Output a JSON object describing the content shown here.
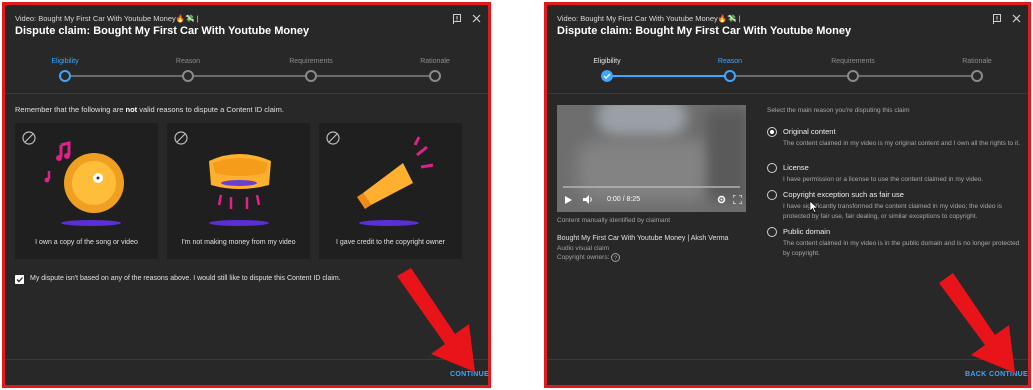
{
  "panel1": {
    "video_title": "Video: Bought My First Car With Youtube Money🔥💸 |",
    "dialog_title": "Dispute claim: Bought My First Car With Youtube Money",
    "steps": [
      "Eligibility",
      "Reason",
      "Requirements",
      "Rationale"
    ],
    "active_step": "Eligibility",
    "note_before": "Remember that the following are ",
    "note_bold": "not",
    "note_after": " valid reasons to dispute a Content ID claim.",
    "cards": [
      {
        "caption": "I own a copy of the song or video"
      },
      {
        "caption": "I'm not making money from my video"
      },
      {
        "caption": "I gave credit to the copyright owner"
      }
    ],
    "checkbox_label": "My dispute isn't based on any of the reasons above. I would still like to dispute this Content ID claim.",
    "checkbox_checked": true,
    "continue_label": "CONTINUE"
  },
  "panel2": {
    "video_title": "Video: Bought My First Car With Youtube Money🔥💸 |",
    "dialog_title": "Dispute claim: Bought My First Car With Youtube Money",
    "steps": [
      "Eligibility",
      "Reason",
      "Requirements",
      "Rationale"
    ],
    "active_step": "Reason",
    "player_time": "0:00 / 8:25",
    "identified_text": "Content manually identified by claimant",
    "claim_title": "Bought My First Car With Youtube Money | Aksh Verma",
    "claim_type": "Audio visual claim",
    "claim_owners": "Copyright owners:",
    "prompt": "Select the main reason you're disputing this claim",
    "options": [
      {
        "label": "Original content",
        "desc": "The content claimed in my video is my original content and I own all the rights to it.",
        "selected": true
      },
      {
        "label": "License",
        "desc": "I have permission or a license to use the content claimed in my video.",
        "selected": false
      },
      {
        "label": "Copyright exception such as fair use",
        "desc": "I have significantly transformed the content claimed in my video; the video is protected by fair use, fair dealing, or similar exceptions to copyright.",
        "selected": false
      },
      {
        "label": "Public domain",
        "desc": "The content claimed in my video is in the public domain and is no longer protected by copyright.",
        "selected": false
      }
    ],
    "back_label": "BACK",
    "continue_label": "CONTINUE"
  },
  "colors": {
    "accent": "#3ea6ff",
    "panel_bg": "#282828",
    "border_red": "#e0191c",
    "arrow_red": "#e8141a",
    "card_art_orange": "#ffb02e",
    "card_art_purple": "#7b3fe4",
    "card_art_pink": "#e0218a"
  },
  "icons": [
    "flag-icon",
    "close-icon",
    "ban-icon",
    "play-icon",
    "volume-icon",
    "settings-icon",
    "fullscreen-icon",
    "help-icon",
    "cursor-icon",
    "arrow-annotation"
  ]
}
